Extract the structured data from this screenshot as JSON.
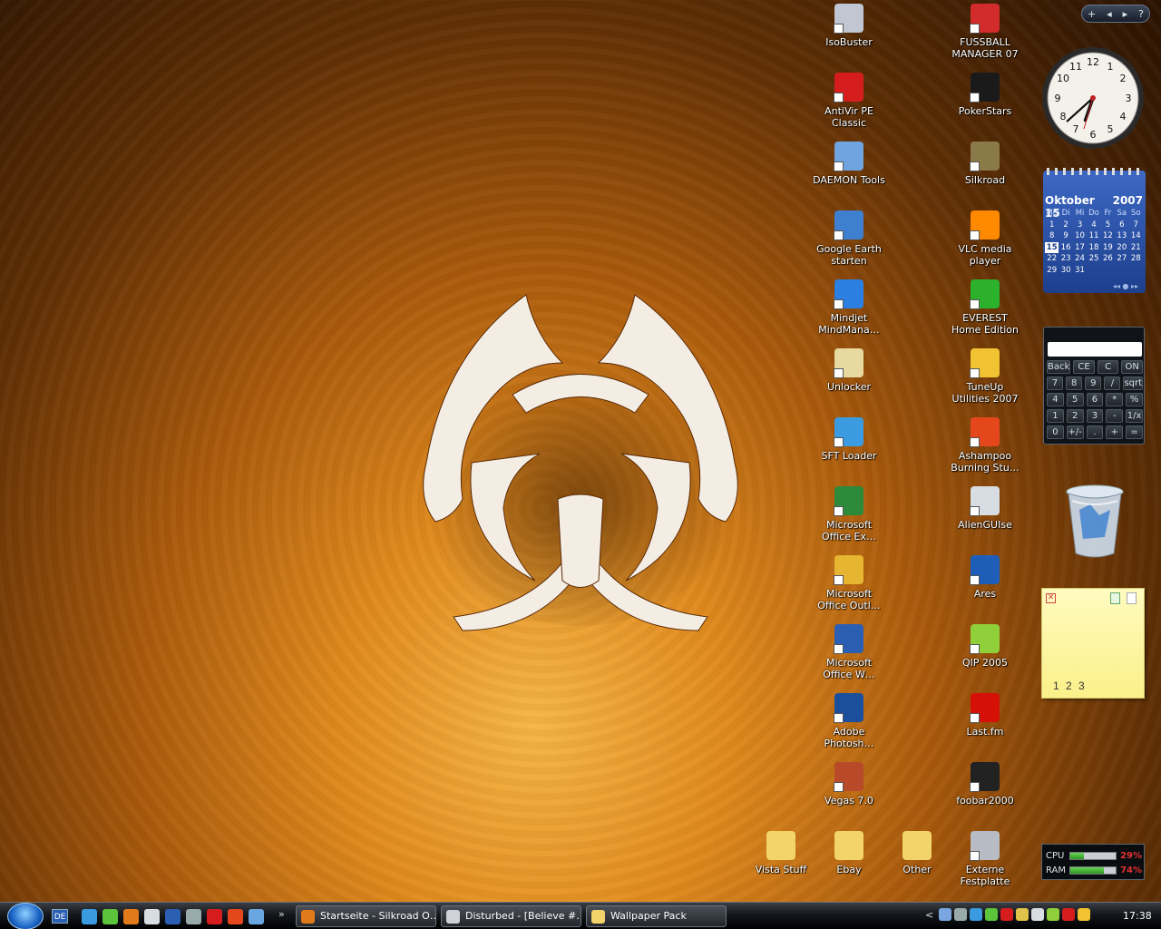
{
  "desktop": {
    "icons_left": [
      {
        "label": "IsoBuster",
        "color": "#c0c6d2",
        "icon": "isobuster-icon"
      },
      {
        "label": "AntiVir PE Classic",
        "color": "#d51d1d",
        "icon": "antivir-icon"
      },
      {
        "label": "DAEMON Tools",
        "color": "#6fa4e0",
        "icon": "daemon-tools-icon"
      },
      {
        "label": "Google Earth starten",
        "color": "#3f7fd0",
        "icon": "google-earth-icon"
      },
      {
        "label": "Mindjet MindMana…",
        "color": "#2a7fe0",
        "icon": "mindjet-icon"
      },
      {
        "label": "Unlocker",
        "color": "#e8d9a0",
        "icon": "unlocker-icon"
      },
      {
        "label": "SFT Loader",
        "color": "#3a9be0",
        "icon": "sft-loader-icon"
      },
      {
        "label": "Microsoft Office Ex…",
        "color": "#2c8a3a",
        "icon": "excel-icon"
      },
      {
        "label": "Microsoft Office Outl…",
        "color": "#e6b531",
        "icon": "outlook-icon"
      },
      {
        "label": "Microsoft Office W…",
        "color": "#2a5fb4",
        "icon": "word-icon"
      },
      {
        "label": "Adobe Photosh…",
        "color": "#1b4f9c",
        "icon": "photoshop-icon"
      },
      {
        "label": "Vegas 7.0",
        "color": "#b84a2a",
        "icon": "vegas-icon"
      }
    ],
    "icons_right": [
      {
        "label": "FUSSBALL MANAGER 07",
        "color": "#d22b2b",
        "icon": "fussball-manager-icon"
      },
      {
        "label": "PokerStars",
        "color": "#1a1a1a",
        "icon": "pokerstars-icon"
      },
      {
        "label": "Silkroad",
        "color": "#8a7a4a",
        "icon": "silkroad-icon"
      },
      {
        "label": "VLC media player",
        "color": "#ff8a00",
        "icon": "vlc-icon"
      },
      {
        "label": "EVEREST Home Edition",
        "color": "#2bb12b",
        "icon": "everest-icon"
      },
      {
        "label": "TuneUp Utilities 2007",
        "color": "#f1c232",
        "icon": "tuneup-icon"
      },
      {
        "label": "Ashampoo Burning Stu…",
        "color": "#e5471c",
        "icon": "ashampoo-icon"
      },
      {
        "label": "AlienGUIse",
        "color": "#d8dde3",
        "icon": "alienguise-icon"
      },
      {
        "label": "Ares",
        "color": "#1e5db8",
        "icon": "ares-icon"
      },
      {
        "label": "QIP 2005",
        "color": "#8fcf3a",
        "icon": "qip-icon"
      },
      {
        "label": "Last.fm",
        "color": "#d51007",
        "icon": "lastfm-icon"
      },
      {
        "label": "foobar2000",
        "color": "#222222",
        "icon": "foobar-icon"
      }
    ],
    "icons_bottom": [
      {
        "label": "Vista Stuff",
        "color": "#f2d46a",
        "icon": "folder-icon"
      },
      {
        "label": "Ebay",
        "color": "#f2d46a",
        "icon": "folder-icon"
      },
      {
        "label": "Other",
        "color": "#f2d46a",
        "icon": "folder-icon"
      },
      {
        "label": "Externe Festplatte",
        "color": "#b7bcc4",
        "icon": "hard-drive-icon"
      }
    ]
  },
  "sidebar": {
    "controls": {
      "add": "+",
      "prev": "◂",
      "next": "▸",
      "help": "?"
    },
    "clock": {
      "hour": 6,
      "minute": 38
    },
    "calendar": {
      "month": "Oktober 15",
      "year": "2007",
      "weekdays": [
        "Mo",
        "Di",
        "Mi",
        "Do",
        "Fr",
        "Sa",
        "So"
      ],
      "weeks": [
        [
          "1",
          "2",
          "3",
          "4",
          "5",
          "6",
          "7"
        ],
        [
          "8",
          "9",
          "10",
          "11",
          "12",
          "13",
          "14"
        ],
        [
          "15",
          "16",
          "17",
          "18",
          "19",
          "20",
          "21"
        ],
        [
          "22",
          "23",
          "24",
          "25",
          "26",
          "27",
          "28"
        ],
        [
          "29",
          "30",
          "31",
          "",
          "",
          "",
          ""
        ]
      ],
      "today": "15"
    },
    "calculator": {
      "rows": [
        [
          "Back",
          "CE",
          "C",
          "ON"
        ],
        [
          "7",
          "8",
          "9",
          "/",
          "sqrt"
        ],
        [
          "4",
          "5",
          "6",
          "*",
          "%"
        ],
        [
          "1",
          "2",
          "3",
          "-",
          "1/x"
        ],
        [
          "0",
          "+/-",
          ".",
          "+",
          "="
        ]
      ]
    },
    "notes": {
      "text": "1 2 3"
    },
    "meter": {
      "cpu_label": "CPU",
      "cpu_value": "29%",
      "cpu_fraction": 0.29,
      "ram_label": "RAM",
      "ram_value": "74%",
      "ram_fraction": 0.74
    }
  },
  "taskbar": {
    "language": "DE",
    "more": "»",
    "tasks": [
      {
        "label": "Startseite - Silkroad O…",
        "color": "#e07a1a",
        "icon": "firefox-icon"
      },
      {
        "label": "Disturbed - [Believe #…",
        "color": "#cfd3d8",
        "icon": "foobar-icon"
      },
      {
        "label": "Wallpaper Pack",
        "color": "#f2d46a",
        "icon": "folder-icon"
      }
    ],
    "quick_launch": [
      "#3a9be0",
      "#5cc43a",
      "#e07a1a",
      "#d8dde3",
      "#2a5fb4",
      "#9aa",
      "#d51d1d",
      "#e5471c",
      "#6aa7e0"
    ],
    "tray_chevron": "<",
    "tray_icons": [
      "#7aa7e0",
      "#9aa",
      "#3a9be0",
      "#5cc43a",
      "#d51d1d",
      "#e0c34a",
      "#d8dde3",
      "#8fcf3a",
      "#d51d1d",
      "#f1c232"
    ],
    "time": "17:38"
  }
}
